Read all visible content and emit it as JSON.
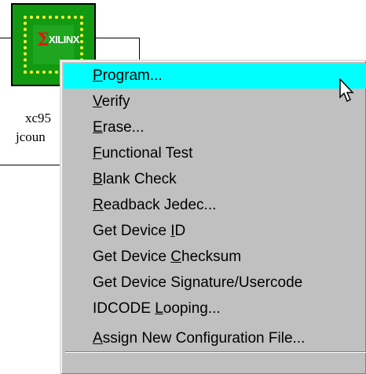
{
  "device": {
    "logo_mark": "Σ",
    "logo_text": "XILINX",
    "name_partial": "xc95",
    "file_partial": "jcoun"
  },
  "menu": {
    "items": [
      {
        "id": "program",
        "pre": "",
        "u": "P",
        "post": "rogram...",
        "selected": true
      },
      {
        "id": "verify",
        "pre": "",
        "u": "V",
        "post": "erify",
        "selected": false
      },
      {
        "id": "erase",
        "pre": "",
        "u": "E",
        "post": "rase...",
        "selected": false
      },
      {
        "id": "functional-test",
        "pre": "",
        "u": "F",
        "post": "unctional Test",
        "selected": false
      },
      {
        "id": "blank-check",
        "pre": "",
        "u": "B",
        "post": "lank Check",
        "selected": false
      },
      {
        "id": "readback-jedec",
        "pre": "",
        "u": "R",
        "post": "eadback Jedec...",
        "selected": false
      },
      {
        "id": "get-device-id",
        "pre": "Get Device ",
        "u": "I",
        "post": "D",
        "selected": false
      },
      {
        "id": "get-device-checksum",
        "pre": "Get Device ",
        "u": "C",
        "post": "hecksum",
        "selected": false
      },
      {
        "id": "get-device-signature",
        "pre": "Get Device Si",
        "u": "g",
        "post": "nature/Usercode",
        "selected": false
      },
      {
        "id": "idcode-looping",
        "pre": "IDCODE ",
        "u": "L",
        "post": "ooping...",
        "selected": false
      },
      {
        "id": "assign-config-file",
        "pre": "",
        "u": "A",
        "post": "ssign New Configuration File...",
        "selected": false
      }
    ]
  },
  "colors": {
    "menu_background": "#c0c0c0",
    "selection_highlight": "#00ffff",
    "chip_green": "#119911",
    "chip_dots": "#ffff33",
    "logo_red": "#ee1111"
  },
  "icons": {
    "cursor": "arrow-pointer-icon"
  }
}
